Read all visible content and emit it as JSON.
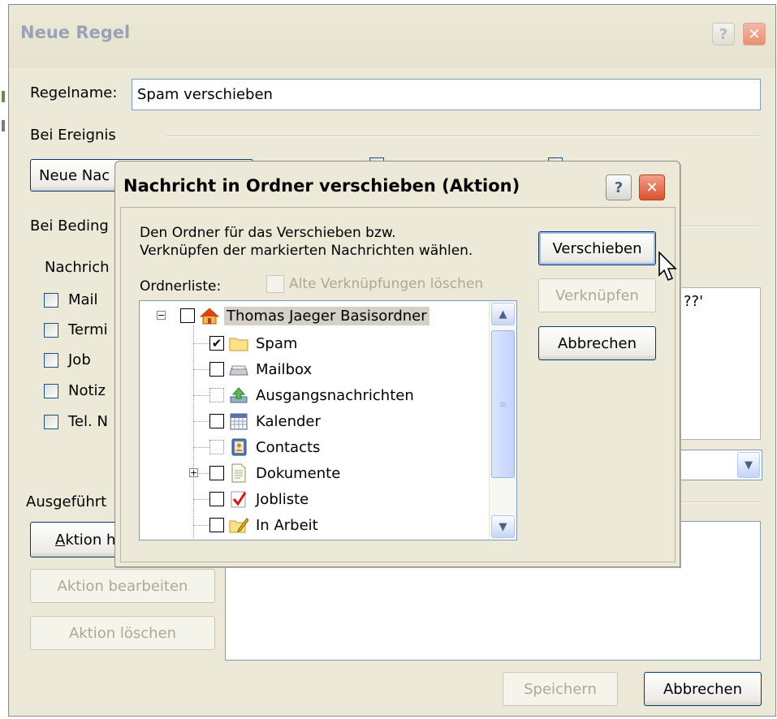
{
  "outer": {
    "title": "Neue Regel",
    "help_symbol": "?",
    "close_symbol": "✕",
    "rule_name_label": "Regelname:",
    "rule_name_value": "Spam verschieben",
    "event_label": "Bei Ereignis",
    "event_dropdown_value": "Neue Nac",
    "condition_label": "Bei Beding",
    "message_label": "Nachrich",
    "type_checkboxes": [
      "Mail",
      "Termi",
      "Job",
      "Notiz",
      "Tel. N"
    ],
    "condition_text_fragment": "??'",
    "actions_label": "Ausgeführt",
    "add_action_label": "Aktion h",
    "edit_action_label": "Aktion bearbeiten",
    "delete_action_label": "Aktion löschen",
    "save_label": "Speichern",
    "cancel_label": "Abbrechen",
    "dropdown_arrow": "▼"
  },
  "dialog": {
    "title": "Nachricht in Ordner verschieben (Aktion)",
    "help_symbol": "?",
    "close_symbol": "✕",
    "description_line1": "Den Ordner für das Verschieben bzw.",
    "description_line2": "Verknüpfen der markierten Nachrichten wählen.",
    "folder_list_label": "Ordnerliste:",
    "delete_old_links_label": "Alte Verknüpfungen löschen",
    "move_button": "Verschieben",
    "link_button": "Verknüpfen",
    "cancel_button": "Abbrechen"
  },
  "tree": {
    "root": {
      "label": "Thomas Jaeger Basisordner",
      "icon": "home-icon",
      "expander": "−"
    },
    "items": [
      {
        "label": "Spam",
        "icon": "folder-icon",
        "checked": true,
        "check_mark": "✔"
      },
      {
        "label": "Mailbox",
        "icon": "mailbox-icon",
        "checked": false
      },
      {
        "label": "Ausgangsnachrichten",
        "icon": "outbox-icon",
        "checked": false
      },
      {
        "label": "Kalender",
        "icon": "calendar-icon",
        "checked": false
      },
      {
        "label": "Contacts",
        "icon": "contacts-icon",
        "checked": false
      },
      {
        "label": "Dokumente",
        "icon": "document-icon",
        "checked": false,
        "expander": "+"
      },
      {
        "label": "Jobliste",
        "icon": "joblist-icon",
        "checked": false
      },
      {
        "label": "In Arbeit",
        "icon": "in-progress-icon",
        "checked": false
      }
    ],
    "scroll_up": "▲",
    "scroll_down": "▼",
    "scroll_grip": "≡"
  },
  "colors": {
    "window_bg": "#ece9d8",
    "close_red": "#d8532b",
    "selection_gray": "#d4d0c8",
    "field_border": "#7f9db9"
  }
}
